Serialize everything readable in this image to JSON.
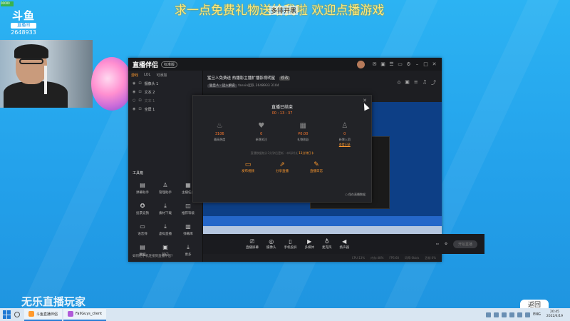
{
  "banner": {
    "text": "求一点免费礼物送给我啦 欢迎点播游戏",
    "overlay_badge": "多排开黑"
  },
  "stream_badge": "00000",
  "platform_logo": {
    "brand": "斗鱼",
    "subtitle": "直播间",
    "room_id": "2648933"
  },
  "bottom_caption": "无乐直播玩家",
  "bottom_tag": "返回",
  "app": {
    "title": "直播伴侣",
    "edition": "标准版",
    "titlebar_icons": [
      "mail-icon",
      "gift-icon",
      "chat-icon",
      "screen-icon",
      "settings-icon",
      "minimize-icon",
      "maximize-icon",
      "close-icon"
    ],
    "left_tabs": [
      {
        "label": "游戏",
        "active": true
      },
      {
        "label": "LOL",
        "active": false
      },
      {
        "label": "可添加",
        "active": false
      }
    ],
    "sources": [
      {
        "label": "摄像头 1",
        "enabled": true
      },
      {
        "label": "文本 2",
        "enabled": true
      },
      {
        "label": "文本 1",
        "enabled": false
      },
      {
        "label": "全屏 1",
        "enabled": true
      }
    ],
    "toolbox_title": "工具箱",
    "tools": [
      {
        "icon": "lottery-icon",
        "label": "弹幕助手"
      },
      {
        "icon": "user-icon",
        "label": "管理助手"
      },
      {
        "icon": "host-icon",
        "label": "主播任务"
      },
      {
        "icon": "vote-icon",
        "label": "投票竞猜"
      },
      {
        "icon": "download-icon",
        "label": "素材下载"
      },
      {
        "icon": "game-icon",
        "label": "推荐等级"
      },
      {
        "icon": "danmu-icon",
        "label": "语音弹"
      },
      {
        "icon": "download2-icon",
        "label": "虚拟直播"
      },
      {
        "icon": "calendar-icon",
        "label": "弹幕库"
      },
      {
        "icon": "data-icon",
        "label": "数据"
      },
      {
        "icon": "hot-icon",
        "label": "热门"
      },
      {
        "icon": "more-icon",
        "label": "更多"
      }
    ],
    "left_footer": "如何把手机连接到直播伴侣?",
    "room_info": {
      "title": "猛旦人免费送 热播影主播扩播影视明星",
      "title_badge": "修改",
      "category": "猛旦人 · 迈入解说",
      "host": "fanxin团队",
      "room_id": "2648933",
      "followers": "3104"
    },
    "right_icons": [
      "shop-icon",
      "gift-box-icon",
      "list-icon",
      "bell-icon",
      "share-icon"
    ],
    "bottom_controls": [
      {
        "icon": "screen-cast-icon",
        "label": "直播屏幕"
      },
      {
        "icon": "camera-icon",
        "label": "摄像头"
      },
      {
        "icon": "phone-icon",
        "label": "手机投屏"
      },
      {
        "icon": "media-icon",
        "label": "多媒体"
      },
      {
        "icon": "mic-icon",
        "label": "麦克风"
      },
      {
        "icon": "speaker-icon",
        "label": "扬声器"
      }
    ],
    "start_live_label": "开始直播",
    "status_items": [
      "CPU:13%",
      "内存:48%",
      "FPS:60",
      "码率:0kb/s",
      "丢帧:0%"
    ]
  },
  "popup": {
    "title": "直播已结束",
    "duration": "00 : 13 : 37",
    "stats": [
      {
        "icon": "fire-icon",
        "value": "3106",
        "label": "最高热度",
        "link": ""
      },
      {
        "icon": "heart-icon",
        "value": "0",
        "label": "新增关注",
        "link": ""
      },
      {
        "icon": "gift-icon",
        "value": "¥0.00",
        "label": "礼物收益",
        "link": ""
      },
      {
        "icon": "users-icon",
        "value": "0",
        "label": "新增入团",
        "link": "查看记录"
      }
    ],
    "note_prefix": "直播数据统计3分钟后更新 · 本场时长",
    "note_highlight": "13分钟打卡",
    "actions": [
      {
        "icon": "video-icon",
        "label": "发布视频"
      },
      {
        "icon": "share-icon",
        "label": "分享直播"
      },
      {
        "icon": "edit-icon",
        "label": "直播日志"
      }
    ],
    "save_option": "保存直播数据"
  },
  "taskbar": {
    "tasks": [
      {
        "label": "斗鱼直播伴侣"
      },
      {
        "label": "FallGuys_client"
      }
    ],
    "lang": "ENG",
    "time": "20:45",
    "date": "2022/4/19"
  }
}
